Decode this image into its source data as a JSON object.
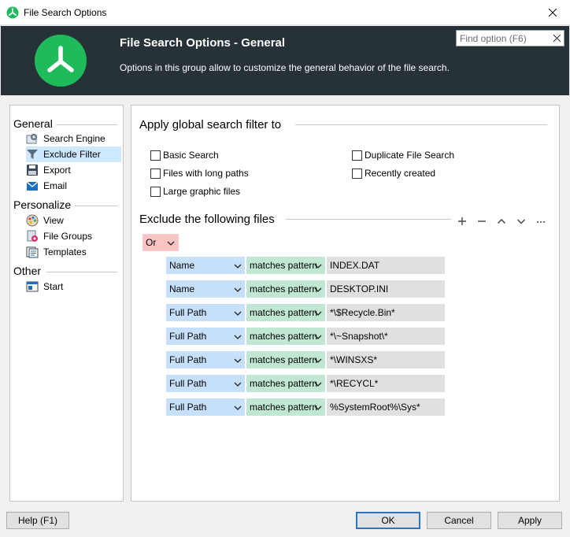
{
  "window": {
    "title": "File Search Options"
  },
  "header": {
    "title": "File Search Options - General",
    "description": "Options in this group allow to customize the general behavior of the file search.",
    "find_placeholder": "Find option (F6)"
  },
  "sidebar": {
    "groups": [
      {
        "label": "General",
        "items": [
          {
            "label": "Search Engine",
            "icon": "gear-icon"
          },
          {
            "label": "Exclude Filter",
            "icon": "funnel-icon",
            "selected": true
          },
          {
            "label": "Export",
            "icon": "floppy-disk-icon"
          },
          {
            "label": "Email",
            "icon": "envelope-icon"
          }
        ]
      },
      {
        "label": "Personalize",
        "items": [
          {
            "label": "View",
            "icon": "palette-icon"
          },
          {
            "label": "File Groups",
            "icon": "file-groups-icon"
          },
          {
            "label": "Templates",
            "icon": "templates-icon"
          }
        ]
      },
      {
        "label": "Other",
        "items": [
          {
            "label": "Start",
            "icon": "start-window-icon"
          }
        ]
      }
    ]
  },
  "filter": {
    "title": "Apply global search filter to",
    "options": [
      {
        "label": "Basic Search",
        "checked": false
      },
      {
        "label": "Duplicate File Search",
        "checked": false
      },
      {
        "label": "Files with long paths",
        "checked": false
      },
      {
        "label": "Recently created",
        "checked": false
      },
      {
        "label": "Large graphic files",
        "checked": false
      }
    ]
  },
  "exclude": {
    "title": "Exclude the following files",
    "toolbar": [
      "plus-icon",
      "minus-icon",
      "chevron-up-icon",
      "chevron-down-icon",
      "more-icon"
    ],
    "operator": "Or",
    "rules": [
      {
        "field": "Name",
        "condition": "matches pattern",
        "value": "INDEX.DAT"
      },
      {
        "field": "Name",
        "condition": "matches pattern",
        "value": "DESKTOP.INI"
      },
      {
        "field": "Full Path",
        "condition": "matches pattern",
        "value": "*\\$Recycle.Bin*"
      },
      {
        "field": "Full Path",
        "condition": "matches pattern",
        "value": "*\\~Snapshot\\*"
      },
      {
        "field": "Full Path",
        "condition": "matches pattern",
        "value": "*\\WINSXS*"
      },
      {
        "field": "Full Path",
        "condition": "matches pattern",
        "value": "*\\RECYCL*"
      },
      {
        "field": "Full Path",
        "condition": "matches pattern",
        "value": "%SystemRoot%\\Sys*"
      }
    ]
  },
  "buttons": {
    "help": "Help (F1)",
    "ok": "OK",
    "cancel": "Cancel",
    "apply": "Apply"
  },
  "colors": {
    "header_bg": "#263238",
    "logo": "#1fbb5b",
    "selection": "#cde8ff",
    "field_blue": "#c6e0fb",
    "field_green": "#bfe7d2",
    "operator_red": "#f8c4c4"
  }
}
